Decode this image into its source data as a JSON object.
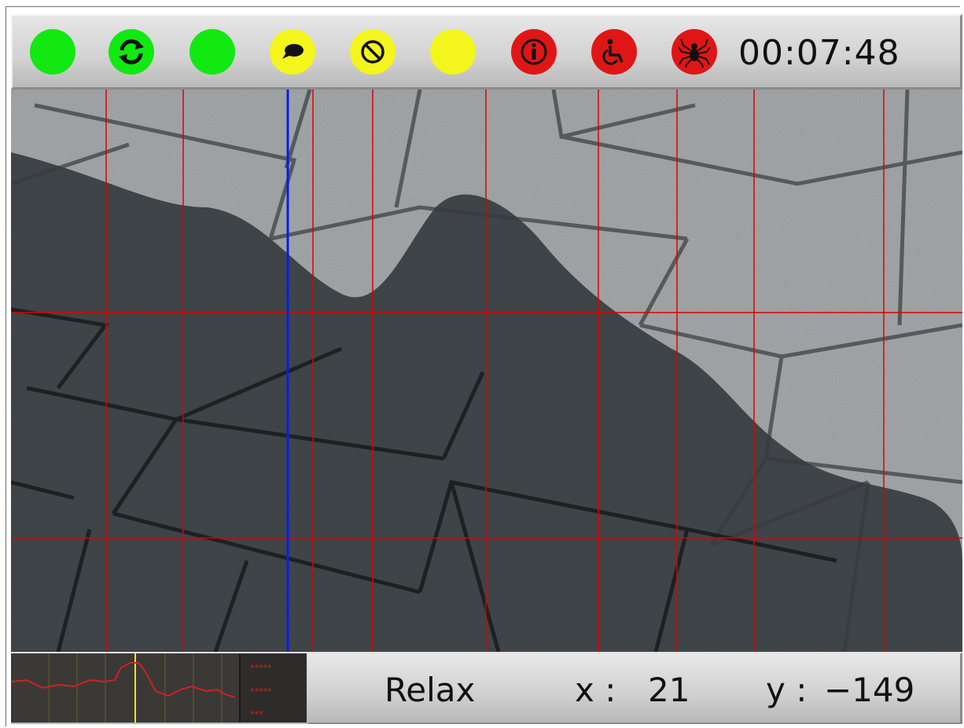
{
  "toolbar": {
    "indicators": [
      {
        "name": "status-light-1",
        "color": "#12e812",
        "icon": "none"
      },
      {
        "name": "sync",
        "color": "#12e812",
        "icon": "sync-icon"
      },
      {
        "name": "status-light-2",
        "color": "#12e812",
        "icon": "none"
      },
      {
        "name": "speech",
        "color": "#f3f51c",
        "icon": "speech-bubble-icon"
      },
      {
        "name": "blocked",
        "color": "#f3f51c",
        "icon": "prohibited-icon"
      },
      {
        "name": "status-light-3",
        "color": "#f3f51c",
        "icon": "none"
      },
      {
        "name": "info",
        "color": "#e01616",
        "icon": "info-icon"
      },
      {
        "name": "accessibility",
        "color": "#e01616",
        "icon": "wheelchair-icon"
      },
      {
        "name": "spider",
        "color": "#e01616",
        "icon": "spider-icon"
      }
    ],
    "timer": "00:07:48"
  },
  "camera": {
    "overlay_grid_color": "#e00000",
    "cursor_line_color": "#0a1ee0"
  },
  "status": {
    "mode": "Relax",
    "x_label": "x :",
    "x_value": "21",
    "y_label": "y :",
    "y_value": "−149"
  },
  "mini_graph": {
    "line_color": "#d42020",
    "marker_color": "#f2e21c",
    "legend": [
      "*****",
      "*****",
      "***"
    ]
  }
}
